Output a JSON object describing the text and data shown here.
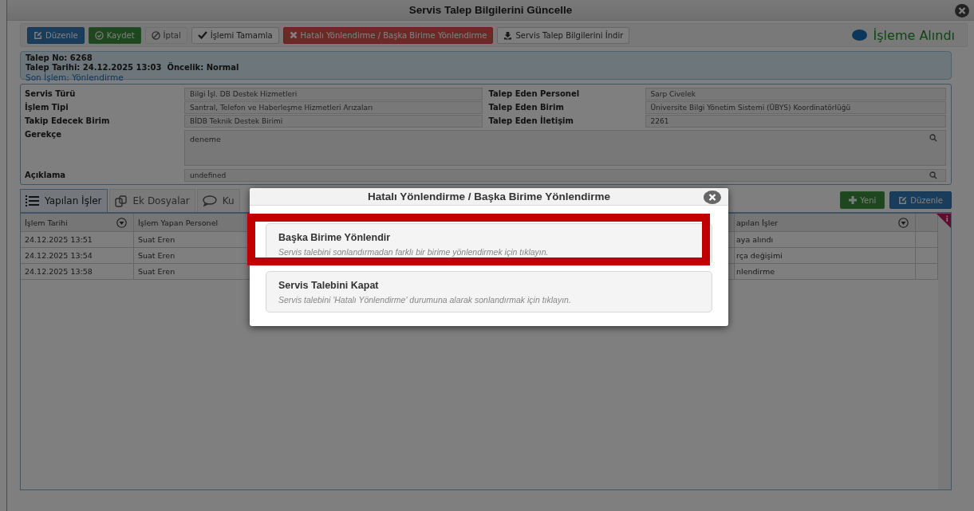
{
  "window": {
    "title": "Servis Talep Bilgilerini Güncelle"
  },
  "toolbar": {
    "buttons": [
      {
        "label": "Düzenle",
        "kind": "edit",
        "disabled": false
      },
      {
        "label": "Kaydet",
        "kind": "save",
        "disabled": true
      },
      {
        "label": "İptal",
        "kind": "cancel",
        "disabled": true
      },
      {
        "label": "İşlemi Tamamla",
        "kind": "complete",
        "disabled": false
      },
      {
        "label": "Hatalı Yönlendirme / Başka Birime Yönlendirme",
        "kind": "redirect",
        "disabled": false
      },
      {
        "label": "Servis Talep Bilgilerini İndir",
        "kind": "download",
        "disabled": false
      }
    ],
    "status": "İşleme Alındı"
  },
  "info": {
    "request_no": "Talep No: 6268",
    "request_date": "Talep Tarihi: 24.12.2025 13:03",
    "priority": "Öncelik: Normal",
    "last_action": "Son İşlem: Yönlendirme"
  },
  "form": {
    "left": [
      {
        "label": "Servis Türü",
        "value": "Bilgi İşl. DB Destek Hizmetleri"
      },
      {
        "label": "İşlem Tipi",
        "value": "Santral, Telefon ve Haberleşme Hizmetleri Arızaları"
      },
      {
        "label": "Takip Edecek Birim",
        "value": "BİDB Teknik Destek Birimi"
      }
    ],
    "right": [
      {
        "label": "Talep Eden Personel",
        "value": "Sarp Civelek"
      },
      {
        "label": "Talep Eden Birim",
        "value": "Üniversite Bilgi Yönetim Sistemi (ÜBYS) Koordinatörlüğü"
      },
      {
        "label": "Talep Eden İletişim",
        "value": "2261"
      }
    ],
    "reason": {
      "label": "Gerekçe",
      "value": "deneme"
    },
    "description": {
      "label": "Açıklama",
      "value": "undefined"
    }
  },
  "tabs": [
    {
      "label": "Yapılan İşler",
      "kind": "list",
      "selected": true
    },
    {
      "label": "Ek Dosyalar",
      "kind": "files",
      "selected": false
    },
    {
      "label": "Ku",
      "kind": "comment",
      "selected": false
    }
  ],
  "tab_buttons": [
    {
      "label": "Yeni",
      "kind": "new",
      "disabled": true
    },
    {
      "label": "Düzenle",
      "kind": "edit",
      "disabled": false
    }
  ],
  "table": {
    "columns": [
      {
        "label": "İşlem Tarihi",
        "filter": true
      },
      {
        "label": "İşlem Yapan Personel",
        "filter": false
      },
      {
        "label": "apılan İşler",
        "filter": true
      },
      {
        "filter": false
      }
    ],
    "rows": [
      [
        "24.12.2025 13:51",
        "Suat Eren",
        "aya alındı"
      ],
      [
        "24.12.2025 13:54",
        "Suat Eren",
        "rça değişimi"
      ],
      [
        "24.12.2025 13:58",
        "Suat Eren",
        "nlendirme"
      ]
    ]
  },
  "modal": {
    "title": "Hatalı Yönlendirme / Başka Birime Yönlendirme",
    "options": [
      {
        "title": "Başka Birime Yönlendir",
        "description": "Servis talebini sonlandırmadan farklı bir birime yönlendirmek için tıklayın.",
        "highlighted": true
      },
      {
        "title": "Servis Talebini Kapat",
        "description": "Servis talebini 'Hatalı Yönlendirme' durumuna alarak sonlandırmak için tıklayın.",
        "highlighted": false
      }
    ]
  }
}
